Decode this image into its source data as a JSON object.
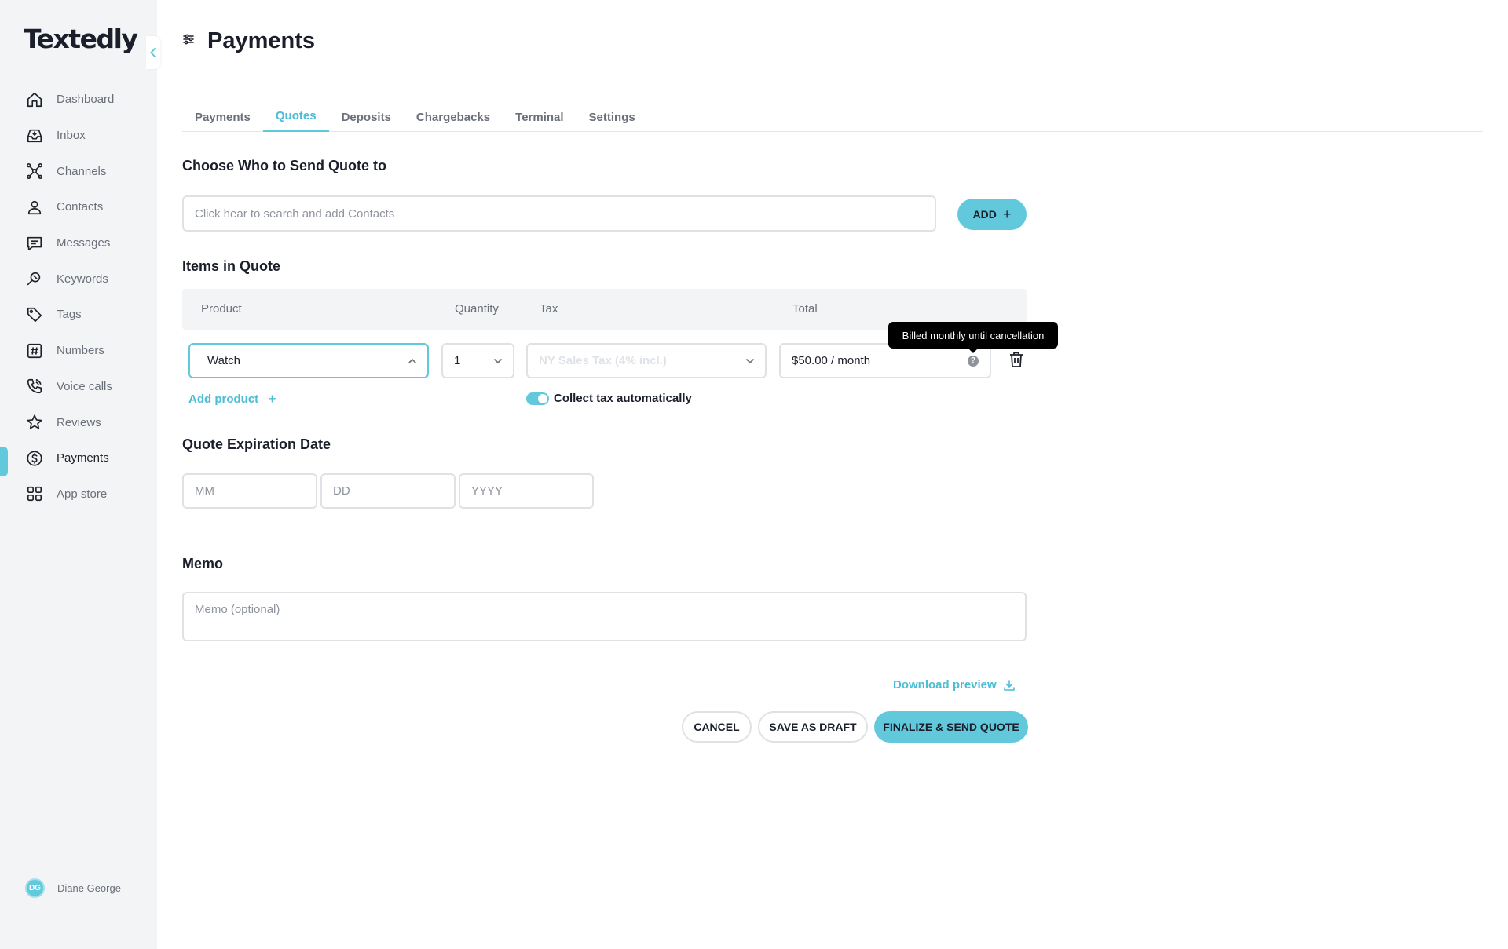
{
  "brand": {
    "logo": "Textedly",
    "accent": "#62c9dc"
  },
  "sidebar": {
    "items": [
      {
        "label": "Dashboard",
        "icon": "home-icon"
      },
      {
        "label": "Inbox",
        "icon": "inbox-icon"
      },
      {
        "label": "Channels",
        "icon": "channels-icon"
      },
      {
        "label": "Contacts",
        "icon": "person-icon"
      },
      {
        "label": "Messages",
        "icon": "message-icon"
      },
      {
        "label": "Keywords",
        "icon": "keyword-search-icon"
      },
      {
        "label": "Tags",
        "icon": "tag-icon"
      },
      {
        "label": "Numbers",
        "icon": "hash-icon"
      },
      {
        "label": "Voice calls",
        "icon": "phone-icon"
      },
      {
        "label": "Reviews",
        "icon": "star-icon"
      },
      {
        "label": "Payments",
        "icon": "dollar-icon",
        "active": true
      },
      {
        "label": "App store",
        "icon": "grid-icon"
      }
    ],
    "user": {
      "initials": "DG",
      "name": "Diane George"
    }
  },
  "header": {
    "title": "Payments"
  },
  "tabs": [
    "Payments",
    "Quotes",
    "Deposits",
    "Chargebacks",
    "Terminal",
    "Settings"
  ],
  "active_tab": "Quotes",
  "recipient": {
    "title": "Choose Who to Send Quote to",
    "placeholder": "Click hear to search and add Contacts",
    "add_label": "ADD",
    "add_icon": "plus-icon"
  },
  "items": {
    "title": "Items in Quote",
    "columns": {
      "product": "Product",
      "quantity": "Quantity",
      "tax": "Tax",
      "total": "Total"
    },
    "row": {
      "product": "Watch",
      "quantity": "1",
      "tax": "NY Sales Tax (4% incl.)",
      "total": "$50.00 / month",
      "help": "?",
      "tooltip": "Billed monthly until cancellation"
    },
    "add_product": "Add product",
    "collect_tax": "Collect tax automatically",
    "collect_tax_on": true
  },
  "expiration": {
    "title": "Quote Expiration Date",
    "mm": "MM",
    "dd": "DD",
    "yyyy": "YYYY"
  },
  "memo": {
    "title": "Memo",
    "placeholder": "Memo (optional)"
  },
  "actions": {
    "download": "Download preview",
    "cancel": "CANCEL",
    "save_draft": "SAVE AS DRAFT",
    "finalize": "FINALIZE & SEND QUOTE"
  }
}
